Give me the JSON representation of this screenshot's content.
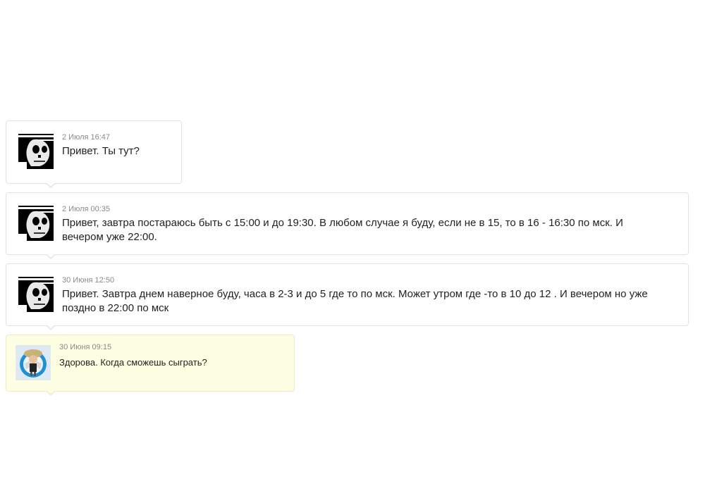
{
  "messages": [
    {
      "date": "2 Июля 16:47",
      "text": "Привет. Ты тут?",
      "avatar_icon": "skull-avatar-icon",
      "own": false
    },
    {
      "date": "2 Июля 00:35",
      "text": "Привет, завтра постараюсь быть с 15:00 и до 19:30. В любом случае я буду, если не в 15, то в 16 - 16:30 по мск. И вечером уже 22:00.",
      "avatar_icon": "skull-avatar-icon",
      "own": false
    },
    {
      "date": "30 Июня 12:50",
      "text": "Привет. Завтра днем наверное буду, часа в 2-3 и до 5 где то по мск. Может утром где -то в 10 до 12 . И вечером но уже поздно в 22:00 по мск",
      "avatar_icon": "skull-avatar-icon",
      "own": false
    },
    {
      "date": "30 Июня 09:15",
      "text": "Здорова. Когда сможешь сыграть?",
      "avatar_icon": "character-avatar-icon",
      "own": true
    }
  ],
  "colors": {
    "own_bubble_bg": "#fefee2",
    "bubble_border": "#e2e2e2",
    "meta_text": "#8a8a8a",
    "body_text": "#222222"
  }
}
